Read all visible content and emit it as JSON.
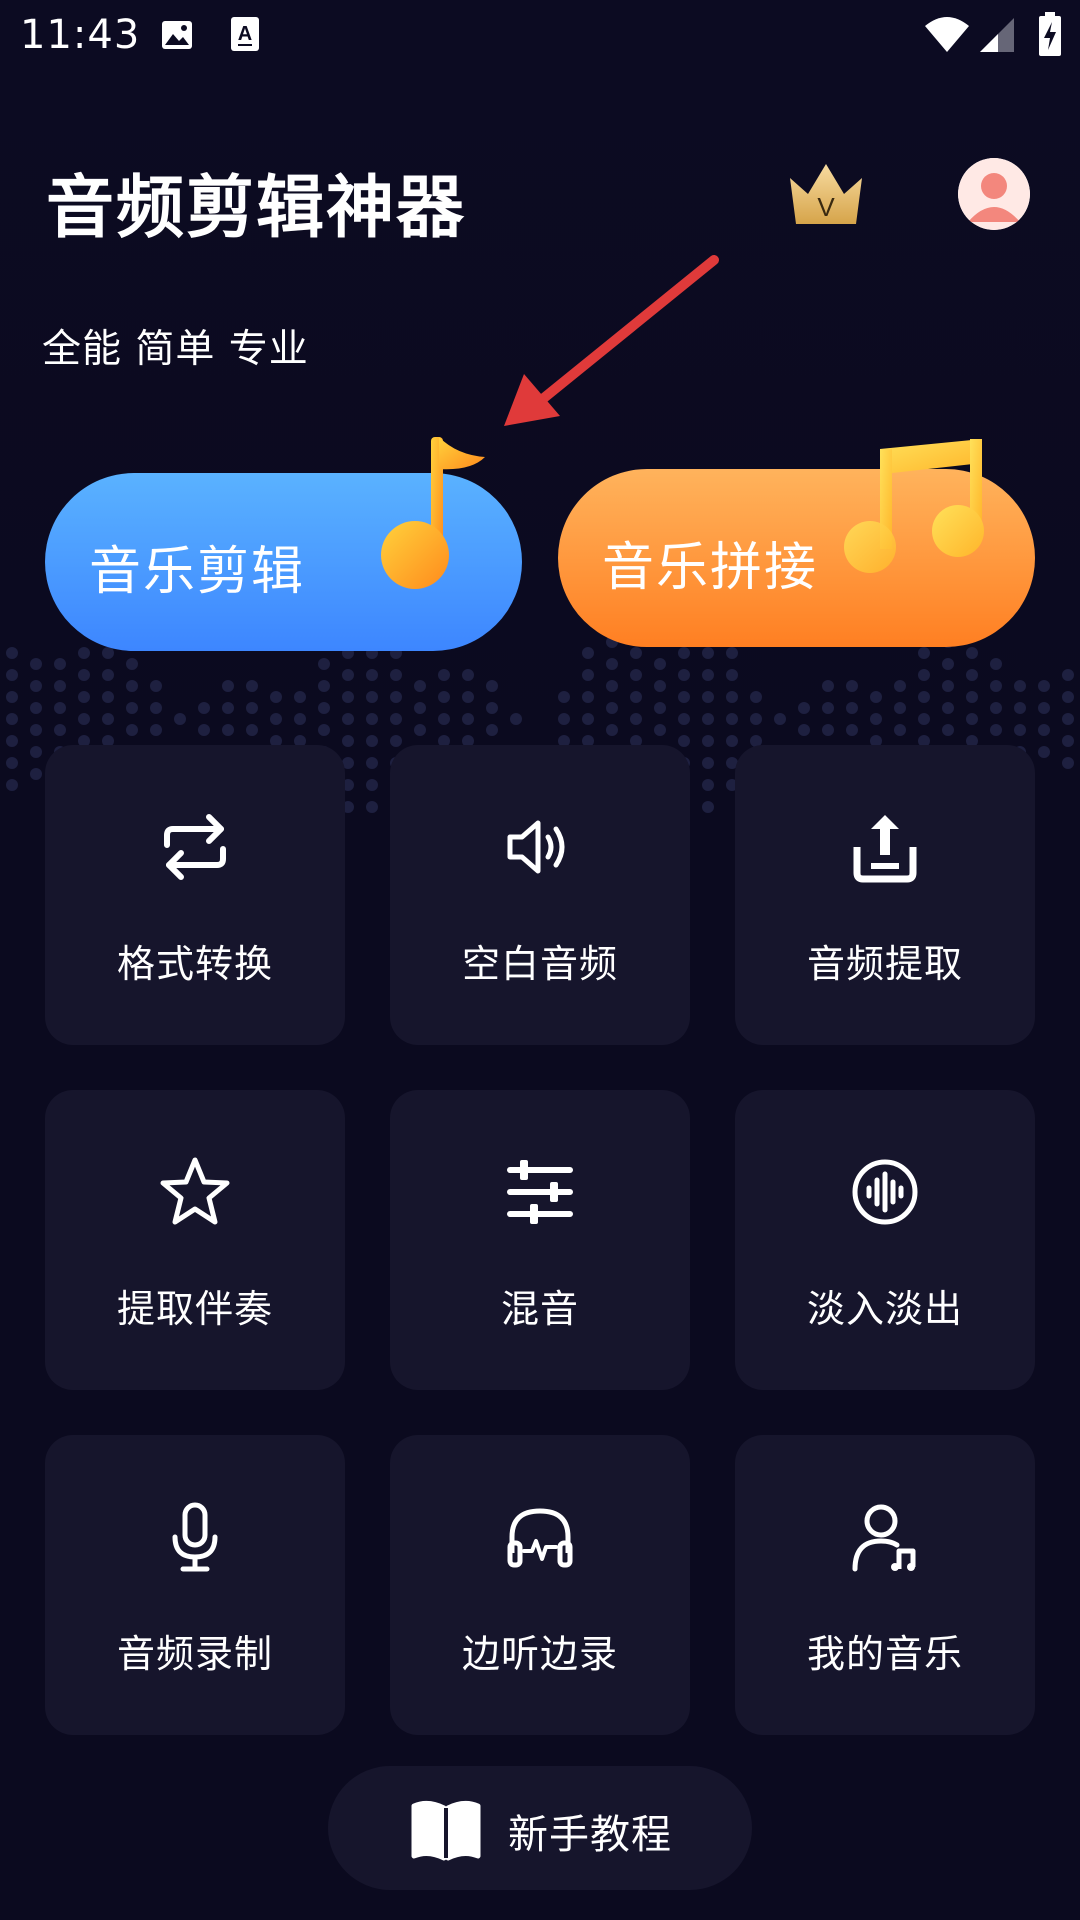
{
  "status_bar": {
    "time": "11:43"
  },
  "header": {
    "title": "音频剪辑神器",
    "subtitle": "全能 简单 专业",
    "vip_icon": "crown-icon",
    "vip_letter": "V",
    "avatar_icon": "user-avatar-icon"
  },
  "main_buttons": [
    {
      "label": "音乐剪辑",
      "icon": "music-note-icon",
      "color": "#3d86ff"
    },
    {
      "label": "音乐拼接",
      "icon": "music-notes-icon",
      "color": "#ff7f22"
    }
  ],
  "features": [
    {
      "label": "格式转换",
      "icon": "convert-arrows-icon"
    },
    {
      "label": "空白音频",
      "icon": "speaker-icon"
    },
    {
      "label": "音频提取",
      "icon": "upload-extract-icon"
    },
    {
      "label": "提取伴奏",
      "icon": "star-icon"
    },
    {
      "label": "混音",
      "icon": "sliders-icon"
    },
    {
      "label": "淡入淡出",
      "icon": "waveform-circle-icon"
    },
    {
      "label": "音频录制",
      "icon": "microphone-icon"
    },
    {
      "label": "边听边录",
      "icon": "headphones-icon"
    },
    {
      "label": "我的音乐",
      "icon": "user-music-icon"
    }
  ],
  "tutorial": {
    "label": "新手教程",
    "icon": "book-icon"
  },
  "colors": {
    "background": "#0b0a1f",
    "tile": "#16152c",
    "blue_button": "#3d86ff",
    "orange_button": "#ff7f22",
    "arrow": "#e03a3a"
  }
}
